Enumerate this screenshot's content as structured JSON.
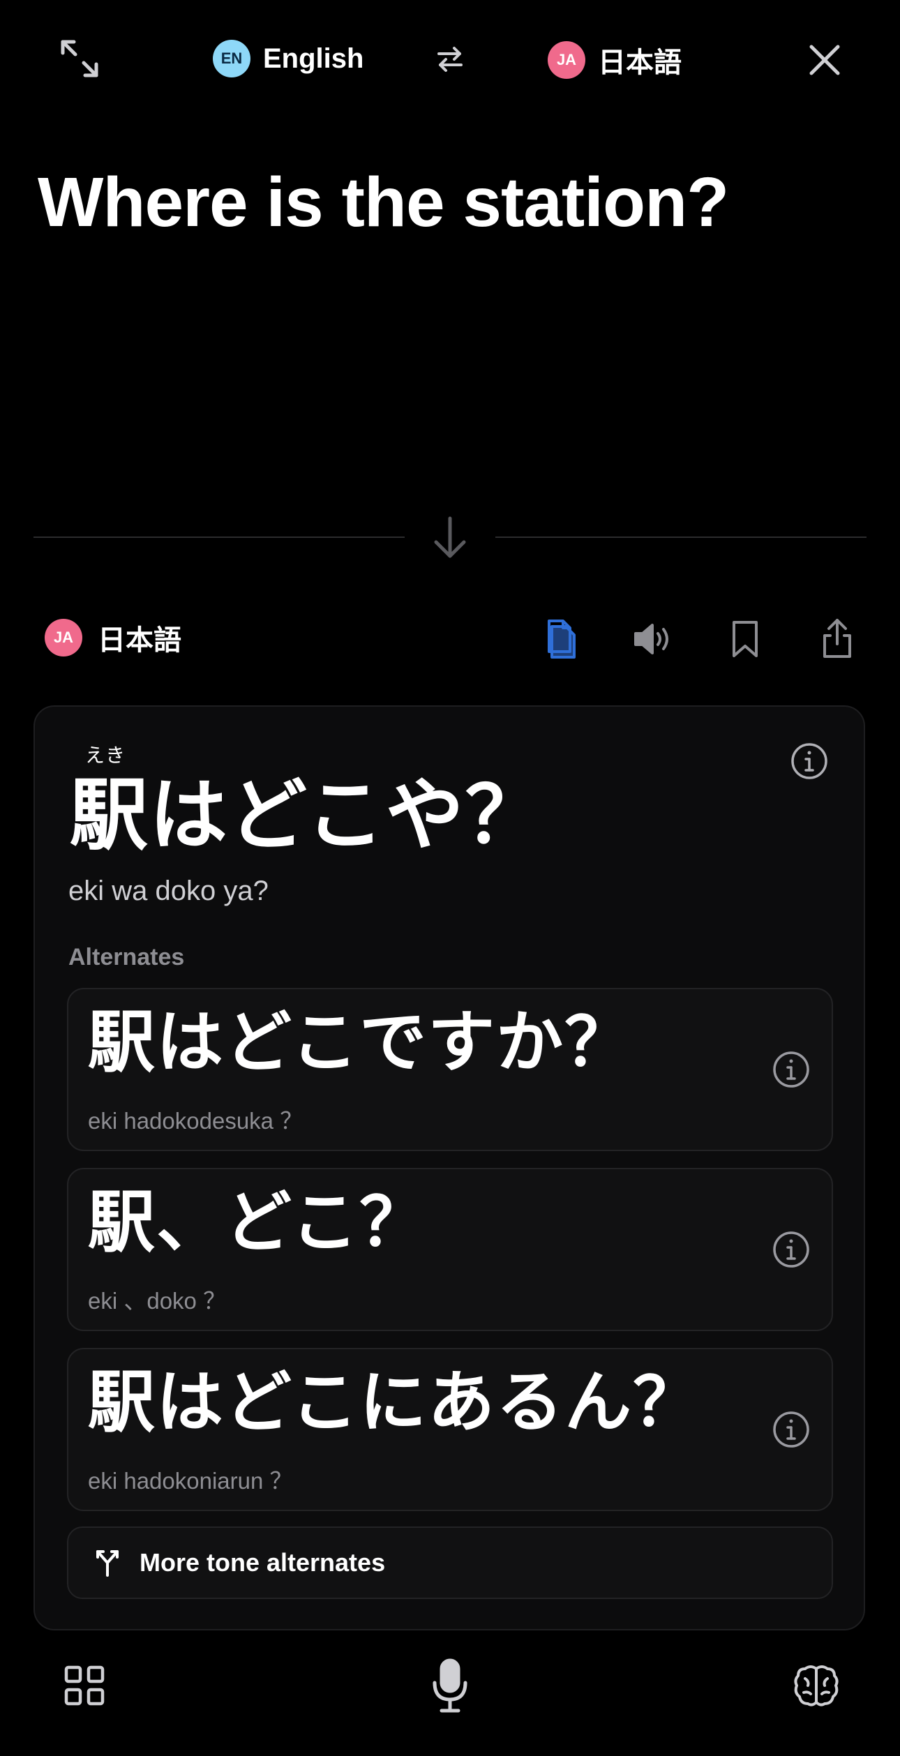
{
  "top_bar": {
    "source_lang": {
      "code": "EN",
      "name": "English"
    },
    "target_lang": {
      "code": "JA",
      "name": "日本語"
    }
  },
  "source": {
    "text": "Where is the station?"
  },
  "target_header": {
    "code": "JA",
    "name": "日本語"
  },
  "translation": {
    "ruby": "えき",
    "text": "駅はどこや？",
    "romaji": "eki wa doko ya?"
  },
  "alternates": {
    "heading": "Alternates",
    "items": [
      {
        "text": "駅はどこですか？",
        "romaji": "eki hadokodesuka ？"
      },
      {
        "text": "駅、どこ？",
        "romaji": "eki 、doko ？"
      },
      {
        "text": "駅はどこにあるん？",
        "romaji": "eki hadokoniarun ？"
      }
    ]
  },
  "more_tone": {
    "label": "More tone alternates"
  },
  "colors": {
    "background": "#000000",
    "accent_blue": "#2f6fd8",
    "badge_en": "#8ed8f8",
    "badge_ja": "#f06a8c"
  },
  "icons": {
    "top_left": "expand-icon",
    "swap": "swap-icon",
    "close": "close-icon",
    "arrow": "arrow-down-icon",
    "copy": "copy-icon",
    "speaker": "speaker-icon",
    "bookmark": "bookmark-icon",
    "share": "share-icon",
    "info": "info-icon",
    "tone": "branch-icon",
    "bottom_left": "grid-icon",
    "bottom_center": "microphone-icon",
    "bottom_right": "brain-icon"
  }
}
